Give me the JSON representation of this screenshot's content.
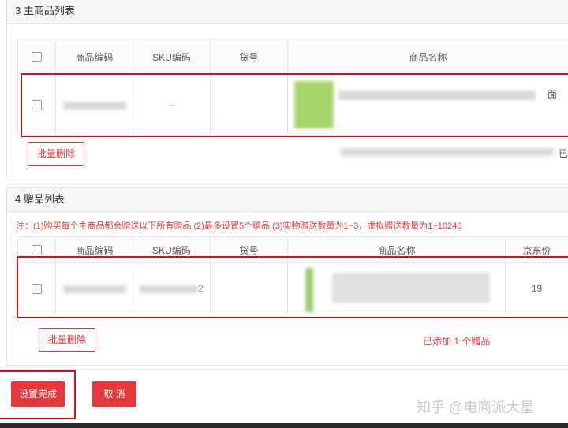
{
  "section_main": {
    "title": "3 主商品列表",
    "columns": [
      "",
      "商品编码",
      "SKU编码",
      "货号",
      "商品名称"
    ],
    "row": {
      "sku": "--",
      "name_tail": "面"
    },
    "batch_delete": "批量删除",
    "right_tail": "已"
  },
  "section_gift": {
    "title": "4 赠品列表",
    "note": "注：(1)购买每个主商品都会赠送以下所有赠品 (2)最多设置5个赠品 (3)实物赠送数量为1~3，虚拟赠送数量为1~10240",
    "columns": [
      "",
      "商品编码",
      "SKU编码",
      "货号",
      "商品名称",
      "京东价"
    ],
    "row": {
      "sku_tail": "2",
      "price": "19"
    },
    "batch_delete": "批量删除",
    "added_text": "已添加 1 个赠品"
  },
  "footer": {
    "confirm_label": "设置完成",
    "cancel_label": "取 消"
  },
  "watermark": "知乎 @电商派大星",
  "colors": {
    "accent": "#e4393c",
    "highlight_frame": "#c8161d"
  }
}
